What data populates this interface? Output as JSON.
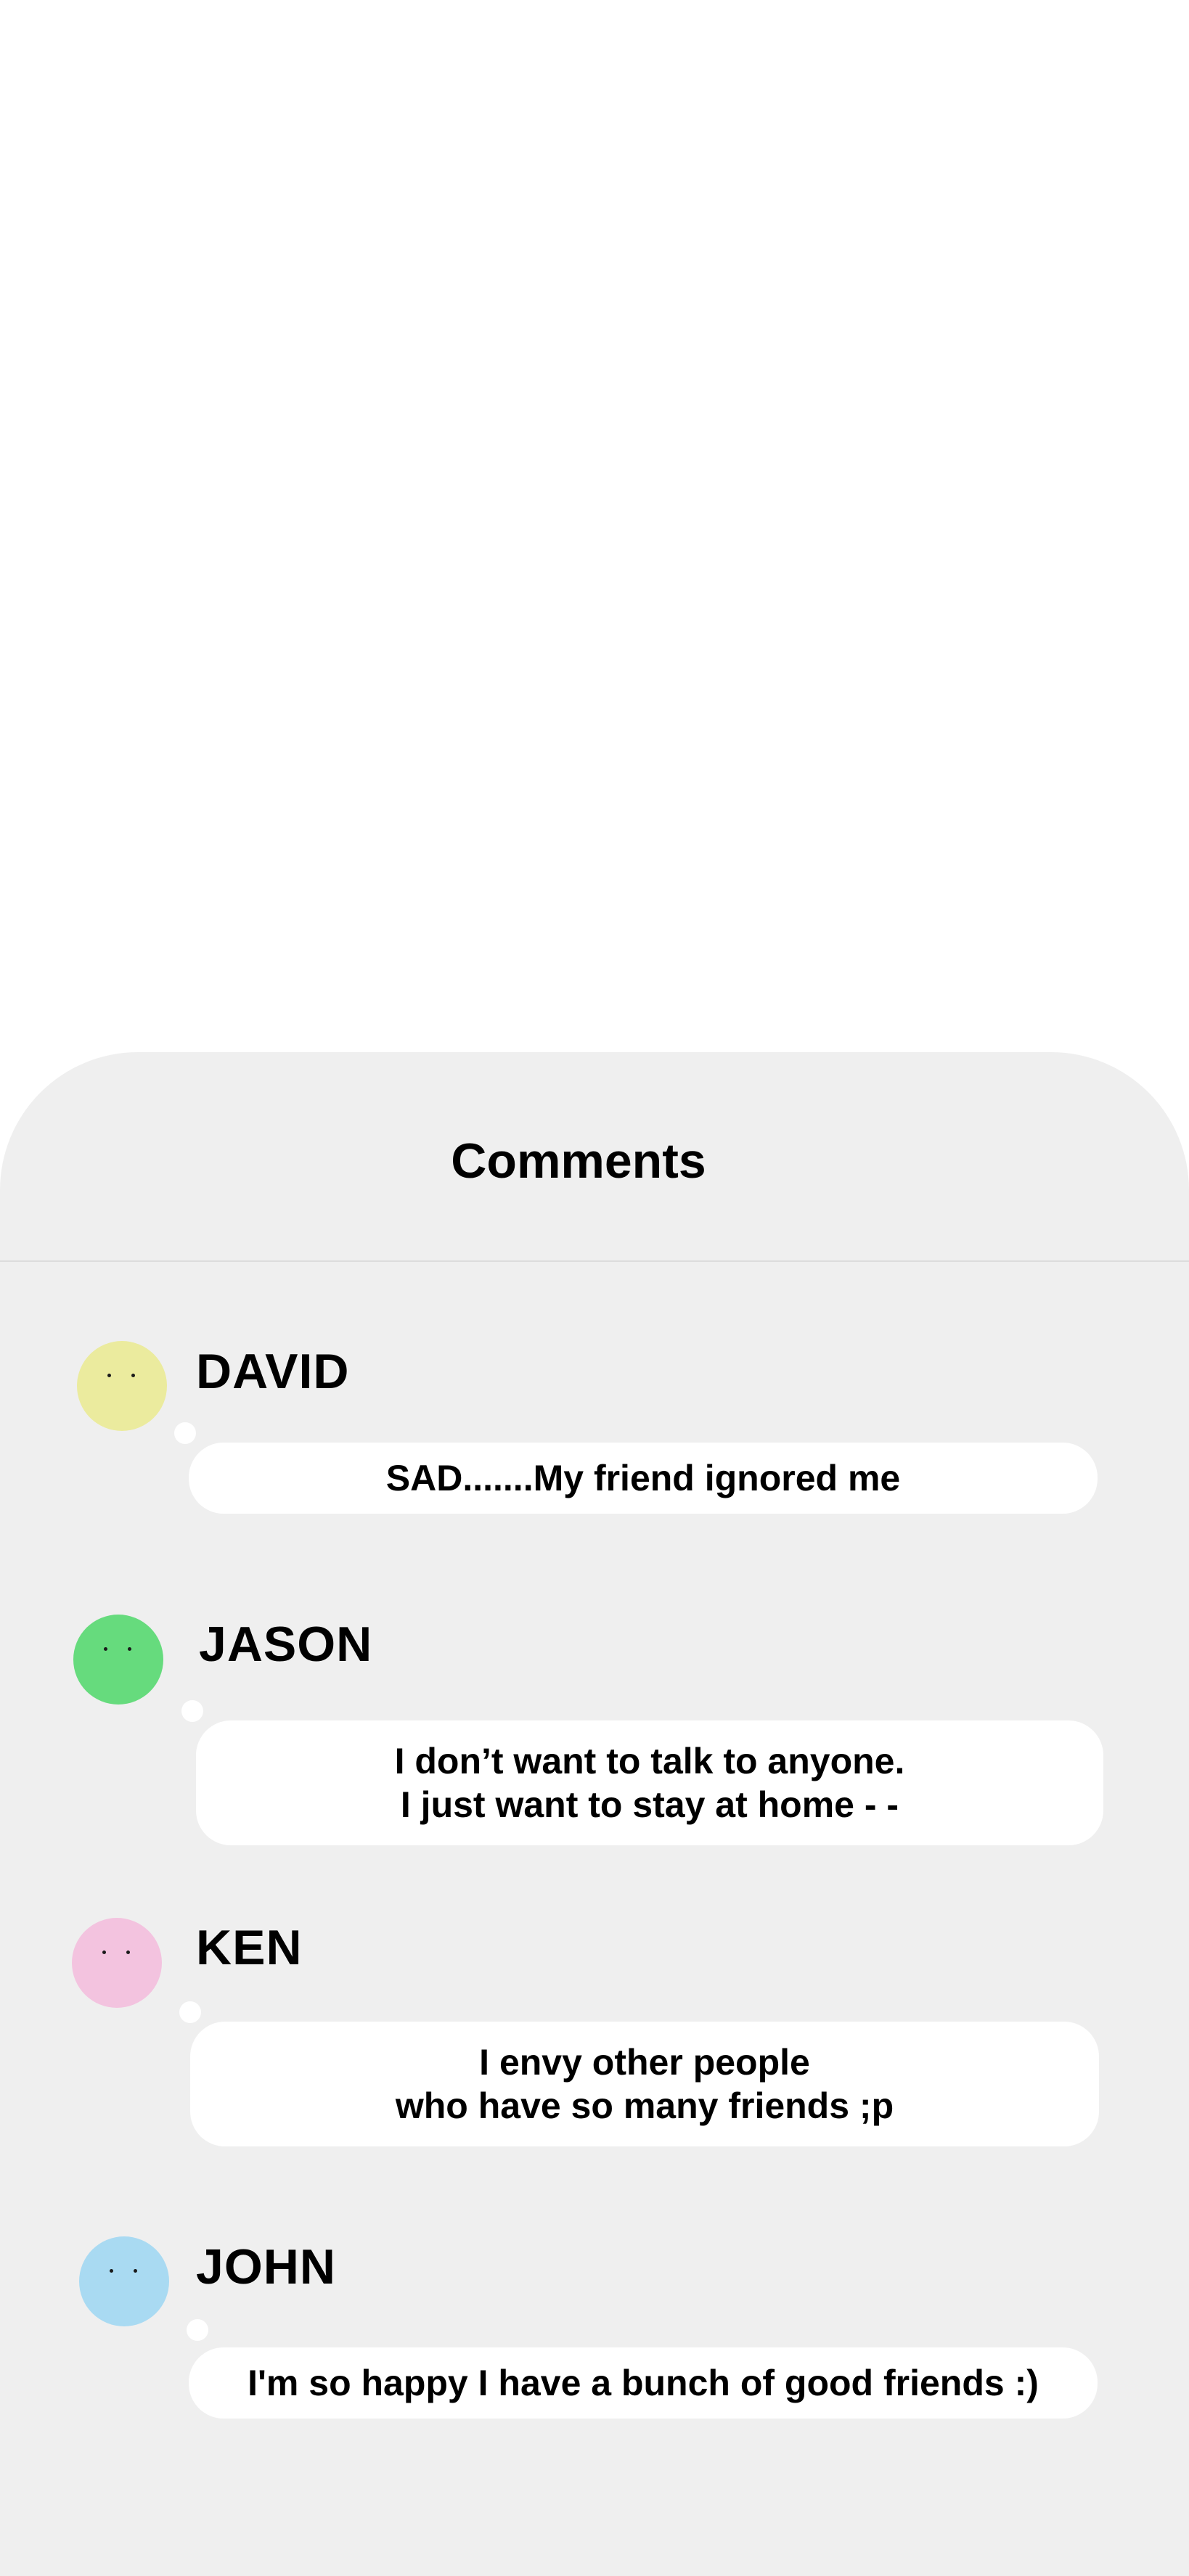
{
  "panel": {
    "title": "Comments"
  },
  "comments": [
    {
      "name": "DAVID",
      "text": "SAD.......My friend ignored me",
      "avatar_color": "#ebeb9e"
    },
    {
      "name": "JASON",
      "text": "I don’t want to talk to anyone.\nI just want to stay at home - -",
      "avatar_color": "#66db7d"
    },
    {
      "name": "KEN",
      "text": "I envy other people\nwho have so many friends ;p",
      "avatar_color": "#f3c3df"
    },
    {
      "name": "JOHN",
      "text": "I'm so happy I have a bunch of good friends :)",
      "avatar_color": "#a9daf2"
    }
  ]
}
